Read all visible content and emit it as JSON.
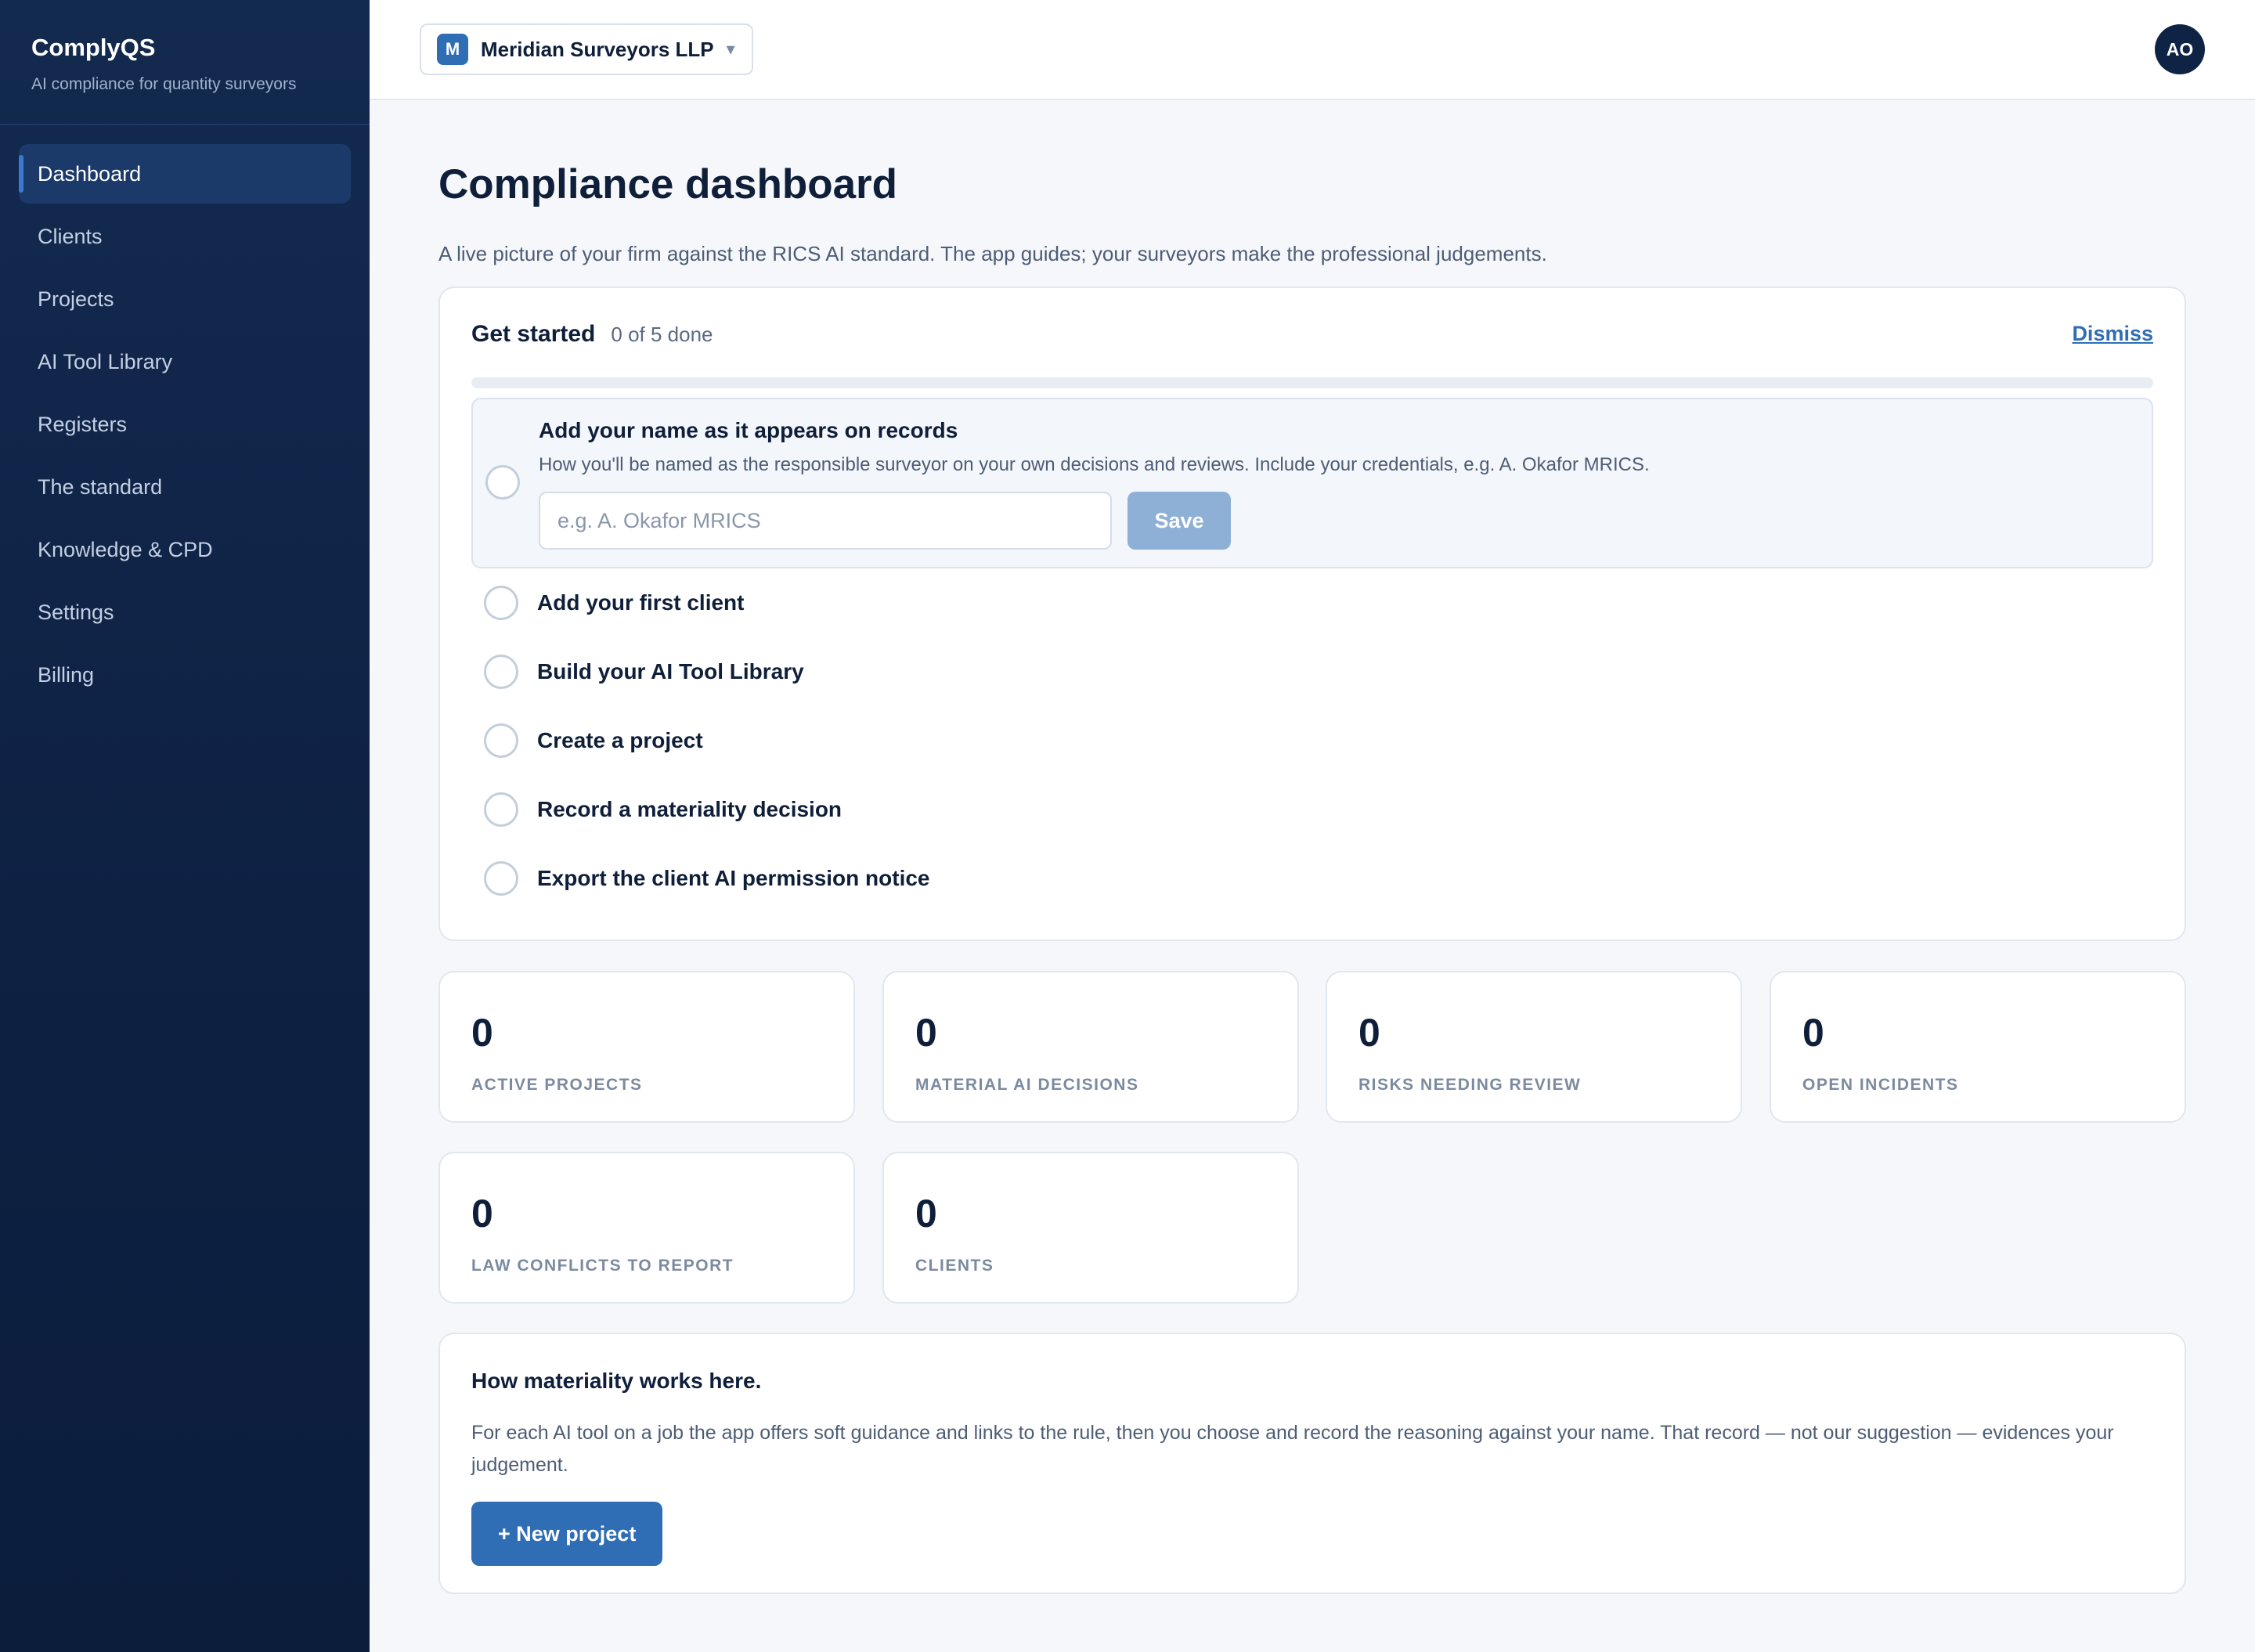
{
  "app": {
    "name": "ComplyQS",
    "tagline": "AI compliance for quantity surveyors"
  },
  "sidebar": {
    "items": [
      {
        "label": "Dashboard",
        "active": true
      },
      {
        "label": "Clients"
      },
      {
        "label": "Projects"
      },
      {
        "label": "AI Tool Library"
      },
      {
        "label": "Registers"
      },
      {
        "label": "The standard"
      },
      {
        "label": "Knowledge & CPD"
      },
      {
        "label": "Settings"
      },
      {
        "label": "Billing"
      }
    ]
  },
  "topbar": {
    "firm_initial": "M",
    "firm_name": "Meridian Surveyors LLP",
    "caret": "▾",
    "user_initials": "AO"
  },
  "main": {
    "title": "Compliance dashboard",
    "subtitle": "A live picture of your firm against the RICS AI standard. The app guides; your surveyors make the professional judgements."
  },
  "get_started": {
    "title": "Get started",
    "count": "0 of 5 done",
    "progress": 0,
    "dismiss_label": "Dismiss",
    "expanded_step": {
      "title": "Add your name as it appears on records",
      "description": "How you'll be named as the responsible surveyor on your own decisions and reviews. Include your credentials, e.g. A. Okafor MRICS.",
      "input_value": "",
      "input_placeholder": "e.g. A. Okafor MRICS",
      "save_label": "Save"
    },
    "steps": [
      "Add your first client",
      "Build your AI Tool Library",
      "Create a project",
      "Record a materiality decision",
      "Export the client AI permission notice"
    ]
  },
  "stats": [
    {
      "value": "0",
      "label": "ACTIVE PROJECTS"
    },
    {
      "value": "0",
      "label": "MATERIAL AI DECISIONS"
    },
    {
      "value": "0",
      "label": "RISKS NEEDING REVIEW"
    },
    {
      "value": "0",
      "label": "OPEN INCIDENTS"
    },
    {
      "value": "0",
      "label": "LAW CONFLICTS TO REPORT"
    },
    {
      "value": "0",
      "label": "CLIENTS"
    }
  ],
  "info": {
    "title": "How materiality works here.",
    "body": "For each AI tool on a job the app offers soft guidance and links to the rule, then you choose and record the reasoning against your name. That record — not our suggestion — evidences your judgement.",
    "button_label": "+ New project"
  },
  "colors": {
    "accent": "#2f6db5",
    "sidebar_bg": "#0e2143",
    "text_primary": "#0f1f3a",
    "text_muted": "#4d5d75"
  }
}
